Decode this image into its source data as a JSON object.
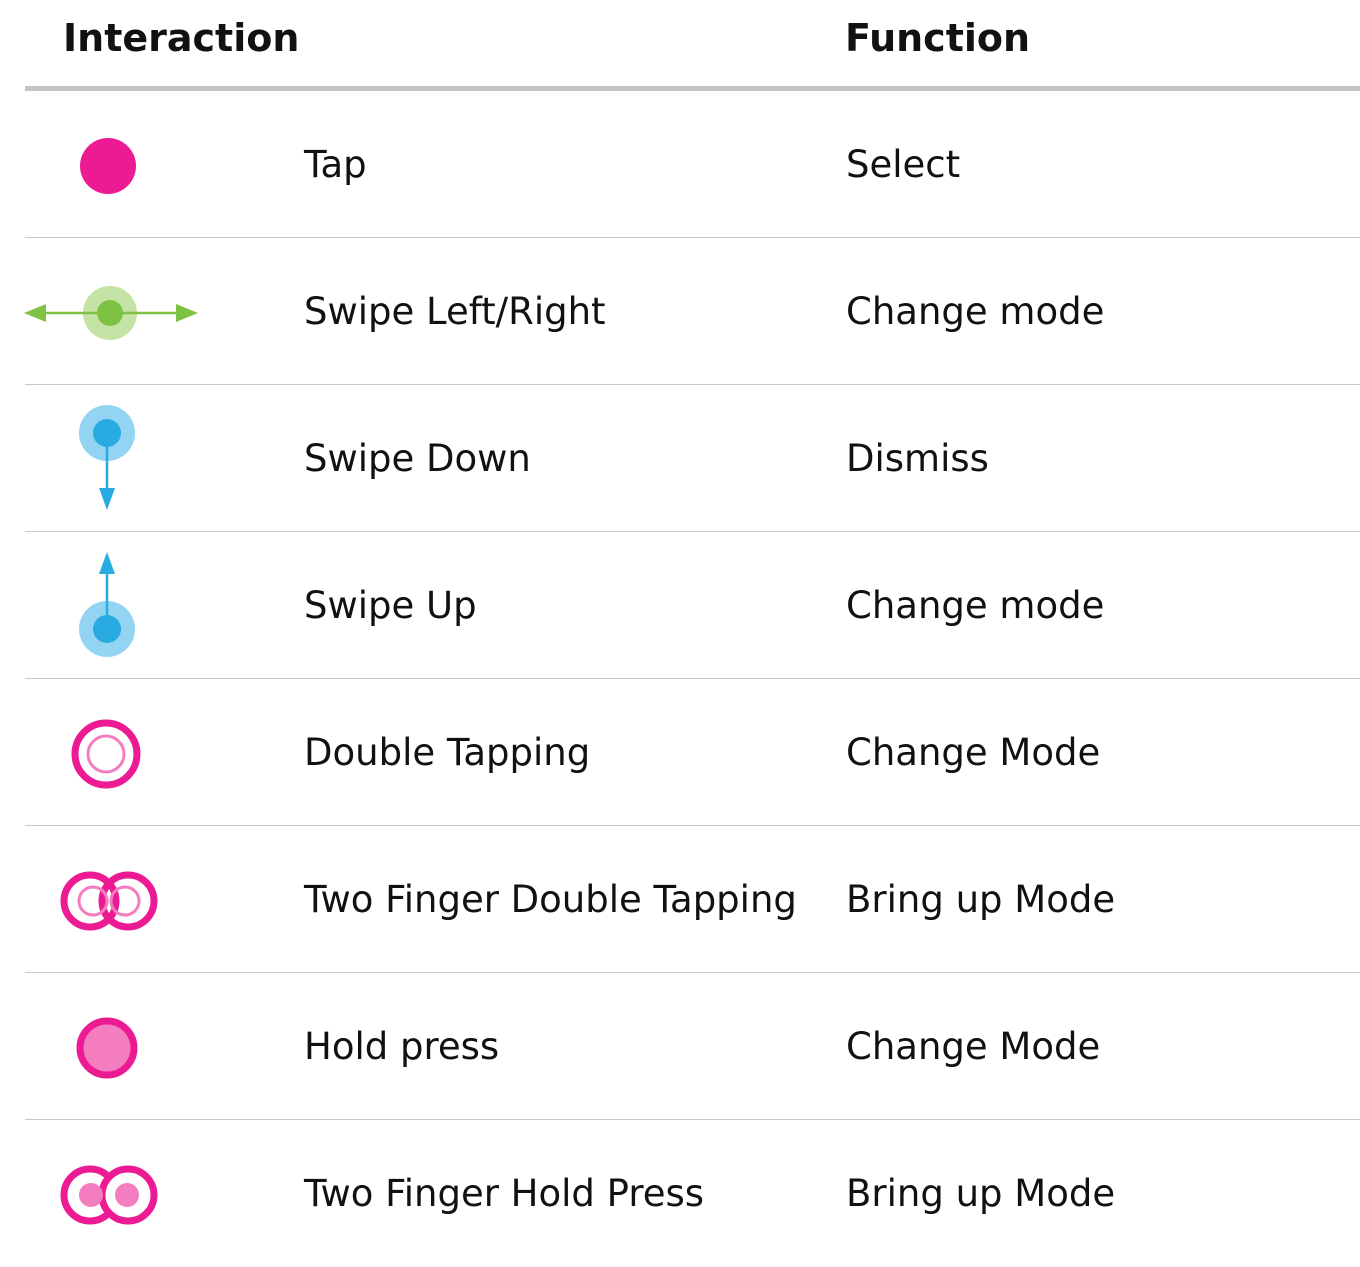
{
  "header": {
    "interaction_title": "Interaction",
    "function_title": "Function"
  },
  "colors": {
    "pink": "#ec1b94",
    "pink_light": "#f47dbf",
    "green": "#7dc242",
    "green_light": "#c5e3a4",
    "blue": "#29abe2",
    "blue_light": "#93d4f3",
    "rule": "#c4c4c4"
  },
  "rows": [
    {
      "icon": "tap-icon",
      "interaction": "Tap",
      "function": "Select"
    },
    {
      "icon": "swipe-left-right-icon",
      "interaction": "Swipe Left/Right",
      "function": "Change mode"
    },
    {
      "icon": "swipe-down-icon",
      "interaction": "Swipe Down",
      "function": "Dismiss"
    },
    {
      "icon": "swipe-up-icon",
      "interaction": "Swipe Up",
      "function": "Change mode"
    },
    {
      "icon": "double-tap-icon",
      "interaction": "Double Tapping",
      "function": "Change Mode"
    },
    {
      "icon": "two-finger-double-tap-icon",
      "interaction": "Two Finger Double Tapping",
      "function": "Bring up Mode"
    },
    {
      "icon": "hold-press-icon",
      "interaction": "Hold press",
      "function": "Change Mode"
    },
    {
      "icon": "two-finger-hold-press-icon",
      "interaction": "Two Finger Hold Press",
      "function": "Bring up Mode"
    }
  ]
}
